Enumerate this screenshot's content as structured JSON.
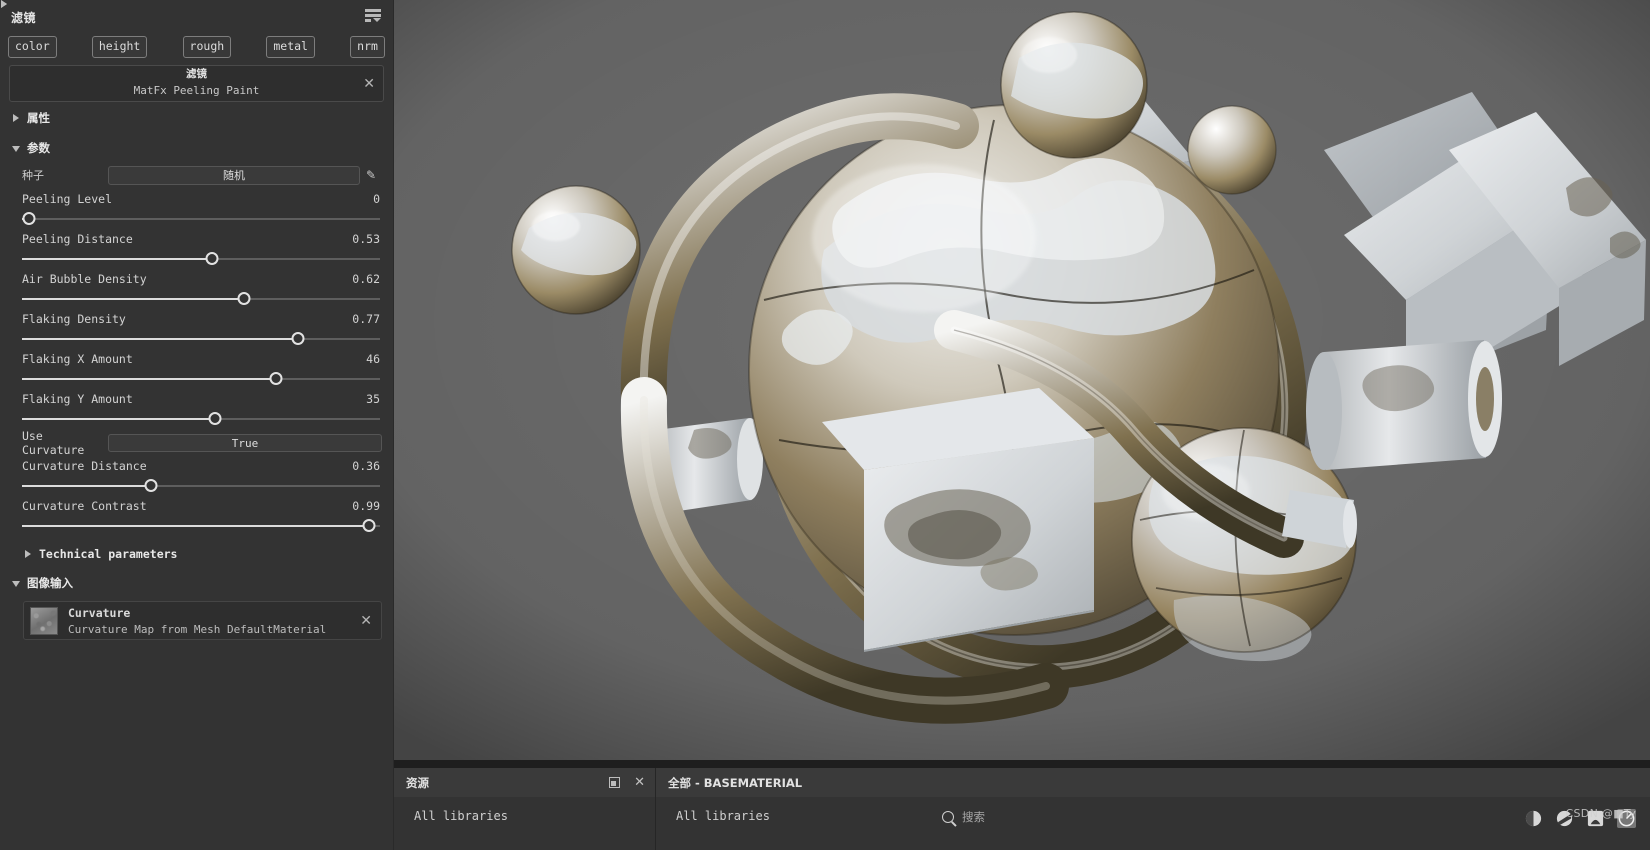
{
  "left_panel": {
    "title": "滤镜",
    "menu_icon": "list-menu-icon",
    "channel_tabs": [
      {
        "label": "color"
      },
      {
        "label": "height"
      },
      {
        "label": "rough"
      },
      {
        "label": "metal"
      },
      {
        "label": "nrm"
      }
    ],
    "filter_card": {
      "kind": "滤镜",
      "name": "MatFx Peeling Paint",
      "close_icon": "close-icon"
    },
    "sections": {
      "attributes": {
        "label": "属性",
        "expanded": false
      },
      "parameters": {
        "label": "参数",
        "expanded": true
      },
      "technical": {
        "label": "Technical parameters",
        "expanded": false
      },
      "image_inputs": {
        "label": "图像输入",
        "expanded": true
      }
    },
    "seed": {
      "label": "种子",
      "button_label": "随机",
      "edit_icon": "pencil-icon"
    },
    "sliders": [
      {
        "label": "Peeling Level",
        "value": "0",
        "pct": 2
      },
      {
        "label": "Peeling Distance",
        "value": "0.53",
        "pct": 53
      },
      {
        "label": "Air Bubble Density",
        "value": "0.62",
        "pct": 62
      },
      {
        "label": "Flaking Density",
        "value": "0.77",
        "pct": 77
      },
      {
        "label": "Flaking X Amount",
        "value": "46",
        "pct": 71
      },
      {
        "label": "Flaking Y Amount",
        "value": "35",
        "pct": 54
      }
    ],
    "use_curvature": {
      "label": "Use Curvature",
      "value": "True"
    },
    "sliders2": [
      {
        "label": "Curvature Distance",
        "value": "0.36",
        "pct": 36
      },
      {
        "label": "Curvature Contrast",
        "value": "0.99",
        "pct": 97
      }
    ],
    "image_input_item": {
      "name": "Curvature",
      "description": "Curvature Map from Mesh DefaultMaterial",
      "thumbnail": "curvature-map-thumbnail",
      "close_icon": "close-icon"
    }
  },
  "assets_panel": {
    "title": "资源",
    "maximize_icon": "maximize-icon",
    "close_icon": "close-icon",
    "tree_root": "All libraries"
  },
  "browser_panel": {
    "breadcrumb": "全部 - BASEMATERIAL",
    "tree_root": "All libraries",
    "search_placeholder": "搜索",
    "search_icon": "search-icon"
  },
  "watermark": "CSDN @■Ty",
  "colors": {
    "panel_bg": "#333333",
    "app_bg": "#1e1e1e",
    "accent_text": "#e6e6e6",
    "slider_fill": "#dcdcdc",
    "slider_track": "#5e5e5e"
  }
}
